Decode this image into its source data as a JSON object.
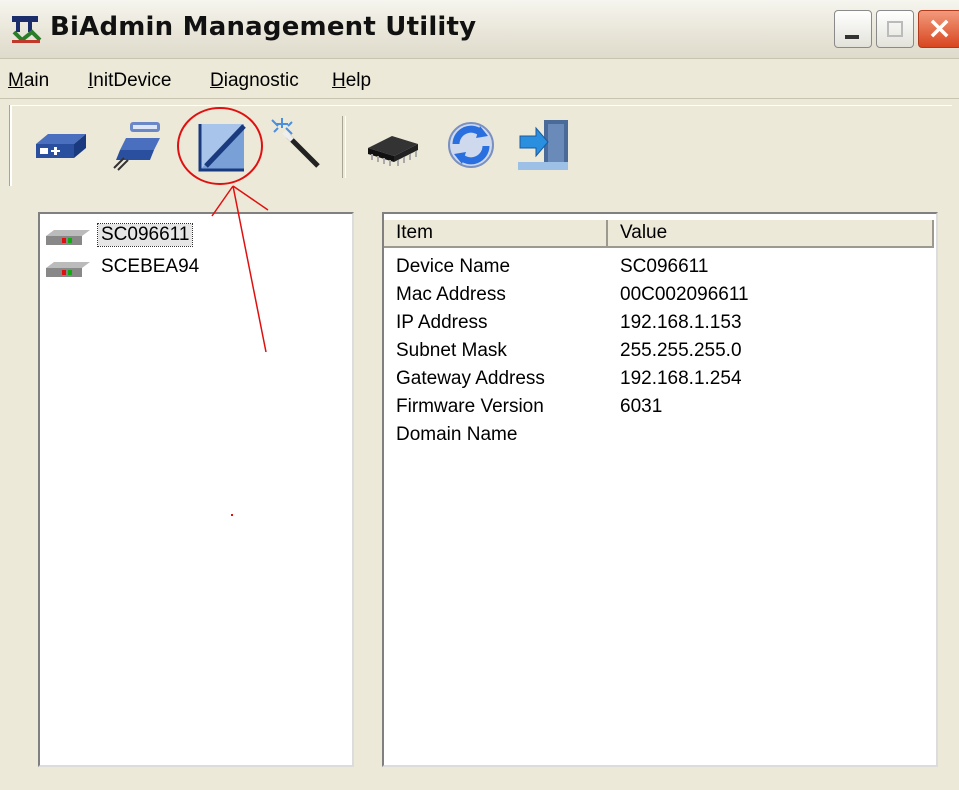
{
  "window": {
    "title": "BiAdmin Management Utility"
  },
  "menu": [
    {
      "label": "Main",
      "accel": "M",
      "rest": "ain"
    },
    {
      "label": "InitDevice",
      "accel": "I",
      "rest": "nitDevice"
    },
    {
      "label": "Diagnostic",
      "accel": "D",
      "rest": "iagnostic"
    },
    {
      "label": "Help",
      "accel": "H",
      "rest": "elp"
    }
  ],
  "toolbar": {
    "icons": [
      "local-device-icon",
      "remote-device-icon",
      "edit-settings-icon",
      "wizard-icon",
      "firmware-chip-icon",
      "refresh-icon",
      "exit-icon"
    ]
  },
  "device_tree": [
    {
      "name": "SC096611",
      "selected": true
    },
    {
      "name": "SCEBEA94",
      "selected": false
    }
  ],
  "details": {
    "columns": [
      "Item",
      "Value"
    ],
    "rows": [
      {
        "item": "Device Name",
        "value": "SC096611"
      },
      {
        "item": "Mac Address",
        "value": "00C002096611"
      },
      {
        "item": "IP Address",
        "value": "192.168.1.153"
      },
      {
        "item": "Subnet Mask",
        "value": "255.255.255.0"
      },
      {
        "item": "Gateway Address",
        "value": "192.168.1.254"
      },
      {
        "item": "Firmware Version",
        "value": "6031"
      },
      {
        "item": "Domain Name",
        "value": ""
      }
    ]
  },
  "colors": {
    "annotation": "#e01010",
    "window_bg": "#ece9d8"
  }
}
